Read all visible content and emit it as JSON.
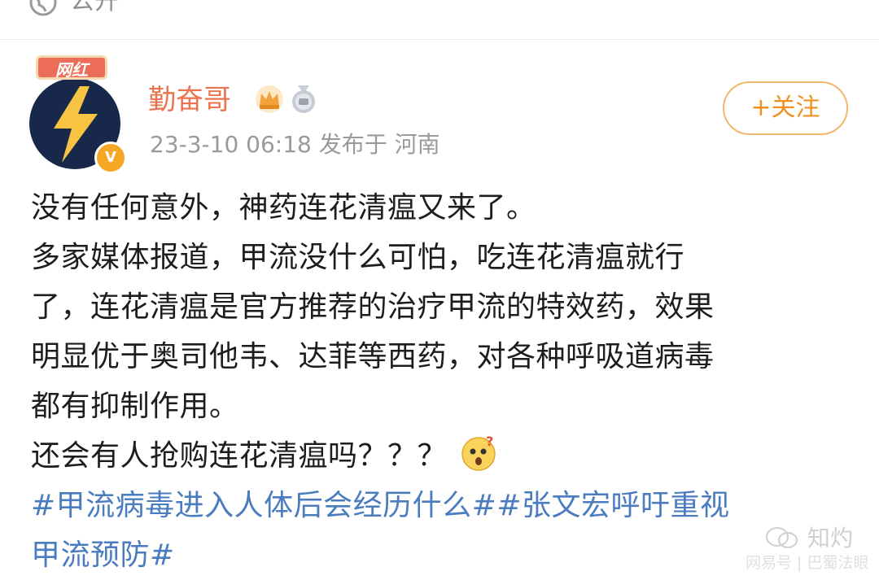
{
  "header": {
    "visibility_label": "公开"
  },
  "author": {
    "badge_tag": "网红",
    "verified_mark": "V",
    "name": "勤奋哥",
    "timestamp": "23-3-10 06:18",
    "location": "发布于 河南",
    "meta_line": "23-3-10 06:18  发布于 河南"
  },
  "follow_button": {
    "label": "+关注"
  },
  "post": {
    "lines": [
      "没有任何意外，神药连花清瘟又来了。",
      "多家媒体报道，甲流没什么可怕，吃连花清瘟就行",
      "了，连花清瘟是官方推荐的治疗甲流的特效药，效果",
      "明显优于奥司他韦、达菲等西药，对各种呼吸道病毒",
      "都有抑制作用。",
      "还会有人抢购连花清瘟吗？？？"
    ],
    "hashtag_lines": [
      "#甲流病毒进入人体后会经历什么##张文宏呼吁重视",
      "甲流预防#"
    ]
  },
  "watermark": {
    "top": "知灼",
    "bottom": "网易号 | 巴蜀法眼"
  },
  "colors": {
    "username": "#eb7350",
    "hashtag": "#4a7cbf",
    "follow": "#f09020",
    "meta": "#9a9a9a"
  }
}
